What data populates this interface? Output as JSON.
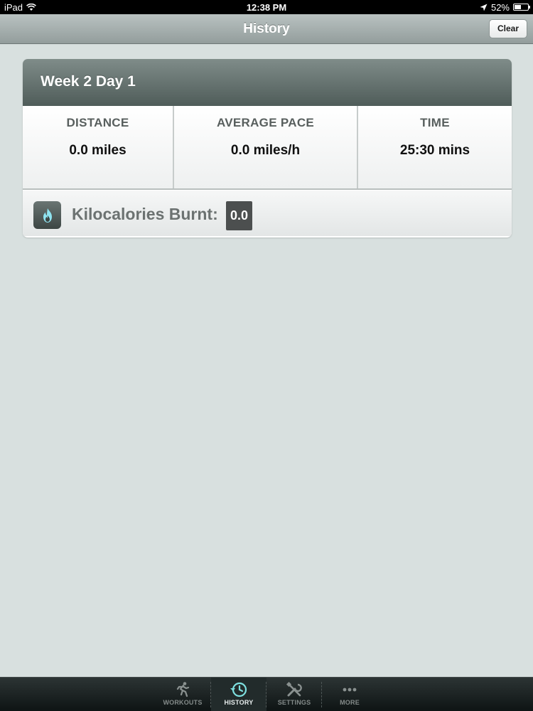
{
  "status_bar": {
    "device": "iPad",
    "time": "12:38 PM",
    "battery_percent": "52%",
    "battery_level": 0.52
  },
  "nav_bar": {
    "title": "History",
    "clear_label": "Clear"
  },
  "history_entry": {
    "title": "Week 2 Day 1",
    "stats": [
      {
        "label": "DISTANCE",
        "value": "0.0 miles"
      },
      {
        "label": "AVERAGE PACE",
        "value": "0.0 miles/h"
      },
      {
        "label": "TIME",
        "value": "25:30 mins"
      }
    ],
    "kcal_label": "Kilocalories Burnt:",
    "kcal_value": "0.0"
  },
  "tab_bar": {
    "tabs": [
      {
        "label": "WORKOUTS",
        "icon": "runner-icon",
        "active": false
      },
      {
        "label": "HISTORY",
        "icon": "clock-history-icon",
        "active": true
      },
      {
        "label": "SETTINGS",
        "icon": "tools-icon",
        "active": false
      },
      {
        "label": "MORE",
        "icon": "more-dots-icon",
        "active": false
      }
    ]
  },
  "colors": {
    "background": "#d8e0df",
    "header": "#5f6c69",
    "active_tab_icon": "#7ee0e0"
  }
}
